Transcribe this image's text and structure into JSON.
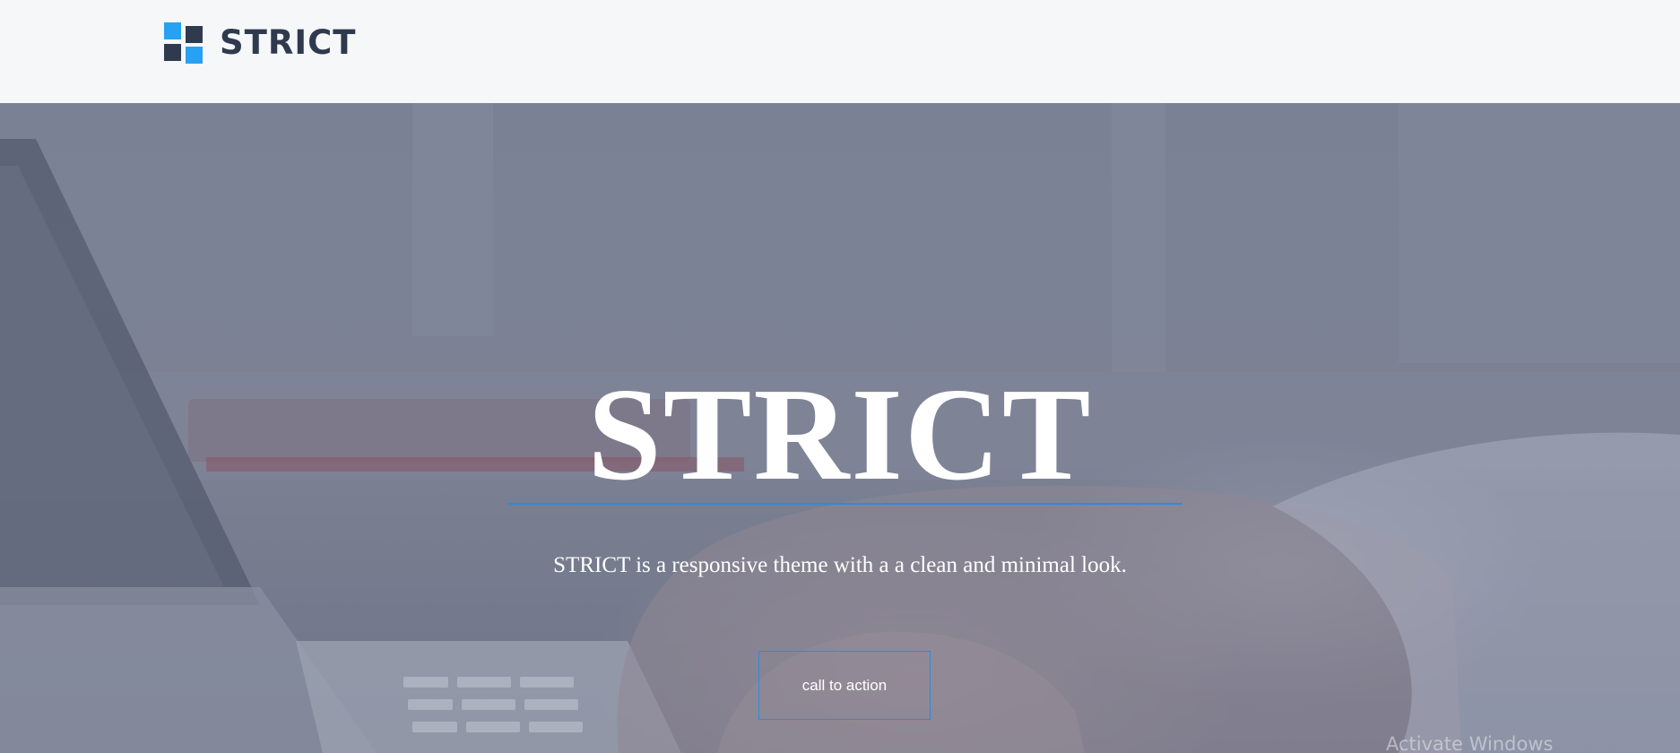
{
  "colors": {
    "header_background": "#f5f7f9",
    "brand_text": "#2f3a4f",
    "brand_mark_blue": "#27a1f2",
    "brand_mark_dark": "#2f3a4f",
    "hero_text": "#ffffff",
    "accent_blue": "#2a8ce0",
    "watermark_text": "#e6e8ee"
  },
  "header": {
    "brand_name": "STRICT",
    "logo_icon": "four-square-grid-logo"
  },
  "hero": {
    "title": "STRICT",
    "subtitle": "STRICT is a responsive theme with a a clean and minimal look.",
    "cta_label": "call to action",
    "background": "photo of hands typing on a laptop keyboard"
  },
  "os_overlay": {
    "watermark": "Activate Windows"
  }
}
